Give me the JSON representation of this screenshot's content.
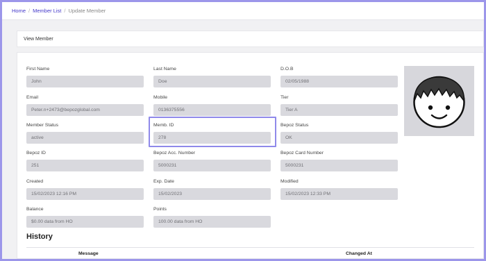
{
  "breadcrumb": {
    "home": "Home",
    "member_list": "Member List",
    "current": "Update Member",
    "sep": "/"
  },
  "card": {
    "title": "View Member"
  },
  "fields": {
    "first_name": {
      "label": "First Name",
      "value": "John"
    },
    "last_name": {
      "label": "Last Name",
      "value": "Doe"
    },
    "dob": {
      "label": "D.O.B",
      "value": "02/05/1988"
    },
    "email": {
      "label": "Email",
      "value": "Peter.n+2473@bepozglobal.com"
    },
    "mobile": {
      "label": "Mobile",
      "value": "0136375556"
    },
    "tier": {
      "label": "Tier",
      "value": "Tier A"
    },
    "member_status": {
      "label": "Member Status",
      "value": "active"
    },
    "memb_id": {
      "label": "Memb. ID",
      "value": "278"
    },
    "bepoz_status": {
      "label": "Bepoz Status",
      "value": "OK"
    },
    "bepoz_id": {
      "label": "Bepoz ID",
      "value": "251"
    },
    "bepoz_acc": {
      "label": "Bepoz Acc. Number",
      "value": "5000231"
    },
    "bepoz_card": {
      "label": "Bepoz Card Number",
      "value": "5000231"
    },
    "created": {
      "label": "Created",
      "value": "15/02/2023  12:16 PM"
    },
    "exp_date": {
      "label": "Exp. Date",
      "value": "15/02/2023"
    },
    "modified": {
      "label": "Modified",
      "value": "15/02/2023  12:33 PM"
    },
    "balance": {
      "label": "Balance",
      "value": "$0.00 data from HO"
    },
    "points": {
      "label": "Points",
      "value": "100.00 data from HO"
    }
  },
  "history": {
    "title": "History",
    "col_message": "Message",
    "col_changed_at": "Changed At"
  },
  "icons": {
    "avatar": "user-avatar-icon"
  },
  "colors": {
    "accent": "#4338ca",
    "highlight": "#8f89ea",
    "field_bg": "#d9d9de",
    "frame": "#9c96ea"
  }
}
